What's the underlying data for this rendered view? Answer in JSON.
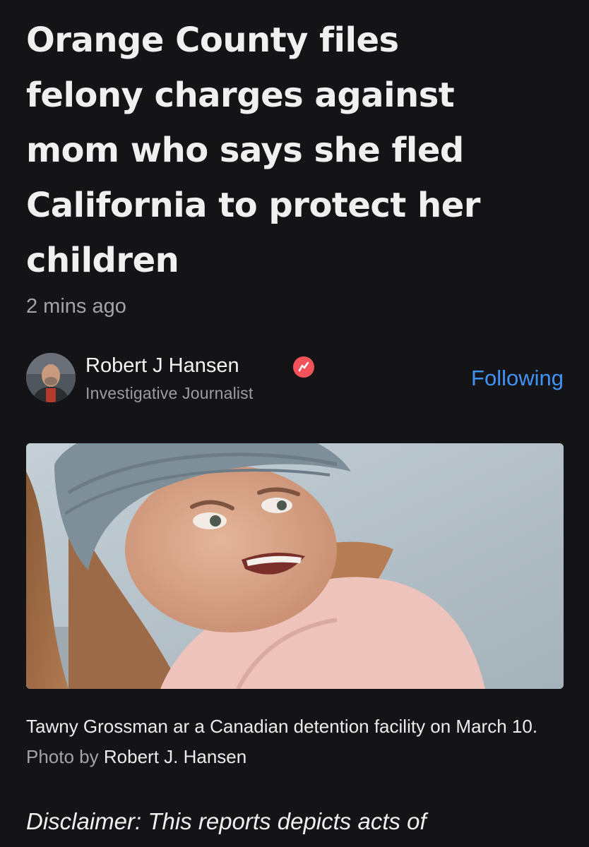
{
  "article": {
    "headline_lines": [
      "Orange County files",
      "felony charges against",
      "mom who says she fled",
      "California to protect her",
      "children"
    ],
    "timestamp": "2 mins ago"
  },
  "author": {
    "name": "Robert J Hansen",
    "role": "Investigative Journalist",
    "follow_label": "Following",
    "avatar_icon": "author-photo",
    "badge_icon": "news-verified-icon",
    "badge_color": "#f4525a"
  },
  "photo": {
    "caption_main": "Tawny Grossman ar a Canadian detention facility on March 10.",
    "credit_label": "Photo by",
    "credit_name": "Robert J. Hansen"
  },
  "body": {
    "disclaimer_start": "Disclaimer: This reports depicts acts of"
  },
  "colors": {
    "background": "#141416",
    "link": "#3f93f4",
    "muted_text": "#a4a4a8"
  }
}
